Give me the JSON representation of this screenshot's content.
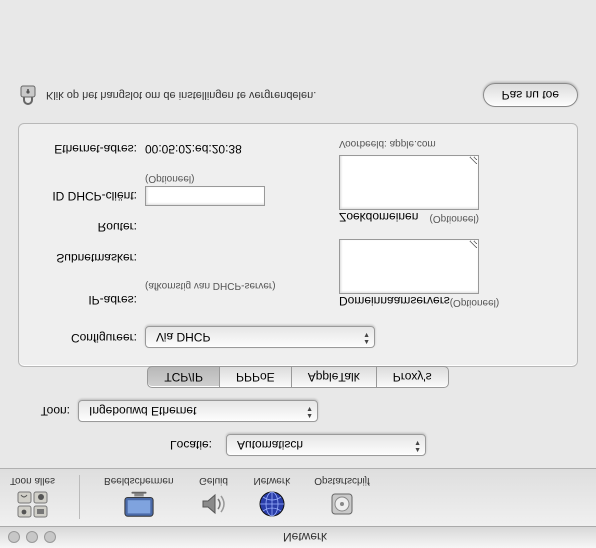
{
  "window": {
    "title": "Netwerk"
  },
  "toolbar": {
    "show_all": "Toon alles",
    "displays": "Beeldschermen",
    "sound": "Geluid",
    "network": "Netwerk",
    "startup": "Opstartschijf"
  },
  "location": {
    "label": "Locatie:",
    "value": "Automatisch"
  },
  "show": {
    "label": "Toon:",
    "value": "Ingebouwd Ethernet"
  },
  "tabs": {
    "tcpip": "TCP/IP",
    "pppoe": "PPPoE",
    "appletalk": "AppleTalk",
    "proxies": "Proxy's"
  },
  "panel": {
    "configure_label": "Configureer:",
    "configure_value": "Via DHCP",
    "ip_label": "IP-adres:",
    "ip_hint": "(afkomstig van DHCP-server)",
    "subnet_label": "Subnetmasker:",
    "router_label": "Router:",
    "dhcp_client_label": "ID DHCP-cliënt:",
    "dhcp_client_hint": "(Optioneel)",
    "ethernet_label": "Ethernet-adres:",
    "ethernet_value": "00:05:02:ed:20:38",
    "dns_title": "Domeinnaamservers",
    "dns_opt": "(Optioneel)",
    "search_title": "Zoekdomeinen",
    "search_opt": "(Optioneel)",
    "example": "Voorbeeld: apple.com"
  },
  "footer": {
    "lock_text": "Klik op het hangslot om de instellingen te vergrendelen.",
    "apply": "Pas nu toe"
  }
}
